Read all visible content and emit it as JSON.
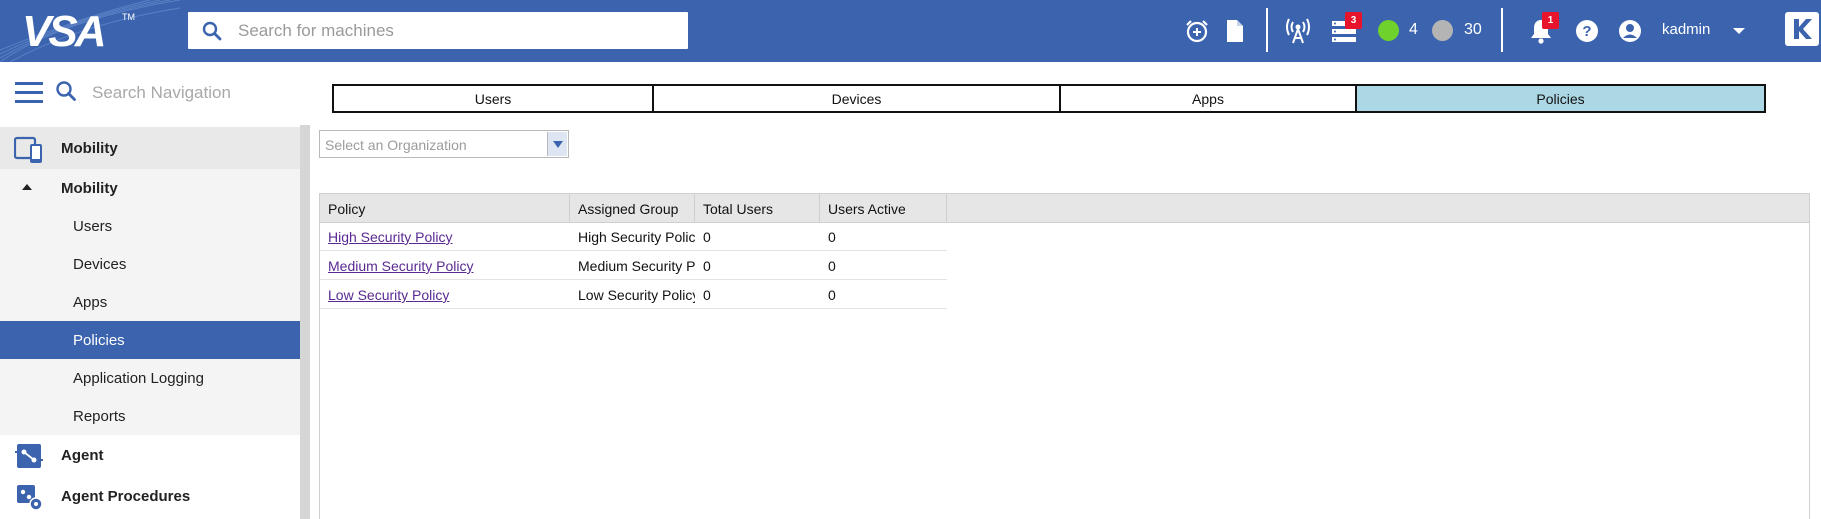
{
  "header": {
    "logo_text": "VSA",
    "logo_tm": "TM",
    "search_placeholder": "Search for machines",
    "servers_badge": "3",
    "online_count": "4",
    "offline_count": "30",
    "notifications_badge": "1",
    "username": "kadmin",
    "colors": {
      "bar": "#3c64ae",
      "online": "#6fd12b",
      "offline": "#b4b4b4",
      "badge": "#e8142b"
    }
  },
  "nav": {
    "search_placeholder": "Search Navigation",
    "module": "Mobility",
    "submodule": "Mobility",
    "items": [
      "Users",
      "Devices",
      "Apps",
      "Policies",
      "Application Logging",
      "Reports"
    ],
    "active_item": "Policies",
    "other_modules": [
      "Agent",
      "Agent Procedures"
    ]
  },
  "main": {
    "tabs": [
      {
        "label": "Users",
        "active": false
      },
      {
        "label": "Devices",
        "active": false
      },
      {
        "label": "Apps",
        "active": false
      },
      {
        "label": "Policies",
        "active": true
      }
    ],
    "org_select_placeholder": "Select an Organization",
    "grid": {
      "columns": [
        "Policy",
        "Assigned Group",
        "Total Users",
        "Users Active"
      ],
      "rows": [
        {
          "policy": "High Security Policy",
          "group": "High Security Policy",
          "total": "0",
          "active": "0"
        },
        {
          "policy": "Medium Security Policy",
          "group": "Medium Security Policy",
          "total": "0",
          "active": "0"
        },
        {
          "policy": "Low Security Policy",
          "group": "Low Security Policy",
          "total": "0",
          "active": "0"
        }
      ]
    }
  }
}
